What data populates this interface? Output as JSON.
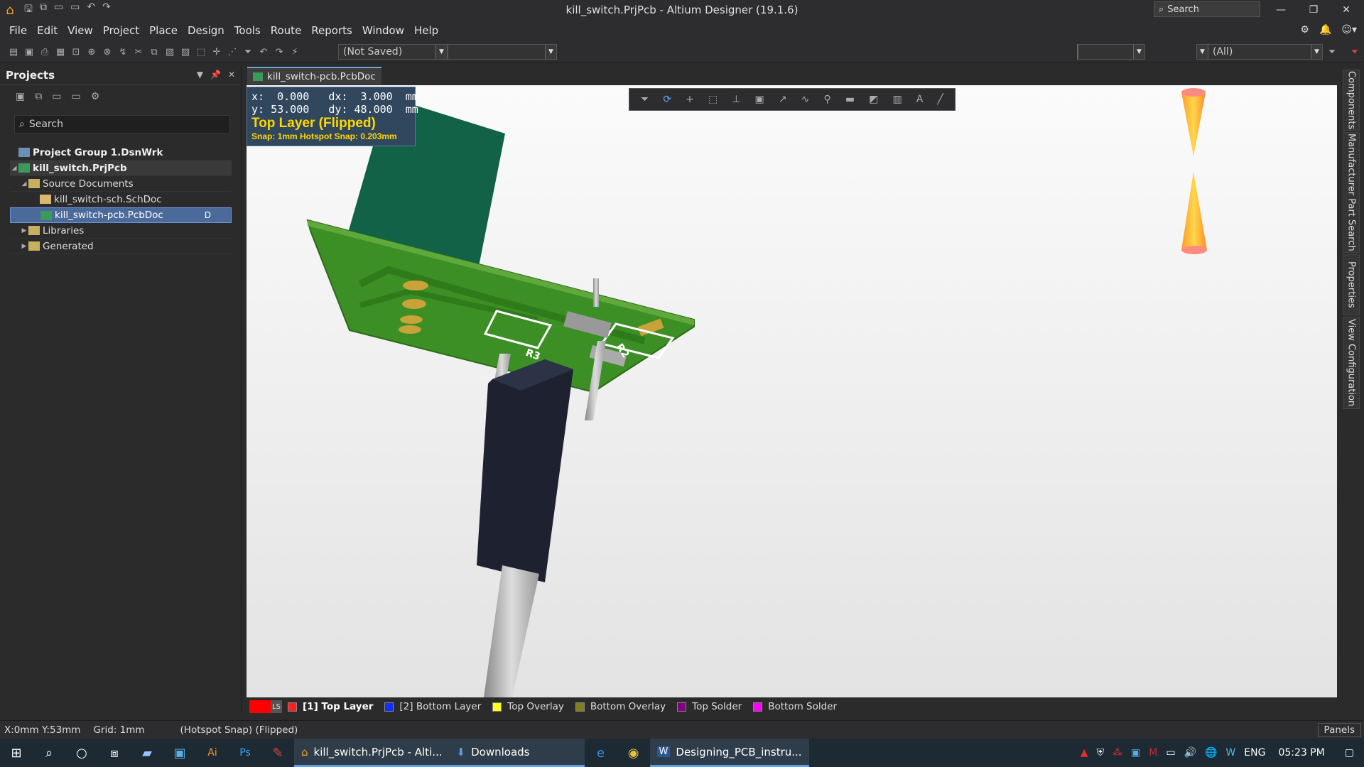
{
  "window": {
    "title": "kill_switch.PrjPcb - Altium Designer (19.1.6)",
    "search_label": "Search"
  },
  "menu": [
    "File",
    "Edit",
    "View",
    "Project",
    "Place",
    "Design",
    "Tools",
    "Route",
    "Reports",
    "Window",
    "Help"
  ],
  "toolbar": {
    "saved_state": "(Not Saved)",
    "filter_all": "(All)"
  },
  "projects_panel": {
    "title": "Projects",
    "search_placeholder": "Search",
    "tree": {
      "group": "Project Group 1.DsnWrk",
      "project": "kill_switch.PrjPcb",
      "source_folder": "Source Documents",
      "sch": "kill_switch-sch.SchDoc",
      "pcb": "kill_switch-pcb.PcbDoc",
      "pcb_flag": "D",
      "libraries": "Libraries",
      "generated": "Generated"
    }
  },
  "document_tab": "kill_switch-pcb.PcbDoc",
  "hud": {
    "line1": "x:  0.000   dx:  3.000  mm",
    "line2": "y: 53.000   dy: 48.000  mm",
    "layer": "Top Layer (Flipped)",
    "snap": "Snap: 1mm Hotspot Snap: 0.203mm"
  },
  "right_panels": [
    "Components",
    "Manufacturer Part Search",
    "Properties",
    "View Configuration"
  ],
  "layers": {
    "ls": "LS",
    "items": [
      {
        "label": "[1] Top Layer",
        "color": "#ff2020",
        "active": true
      },
      {
        "label": "[2] Bottom Layer",
        "color": "#1030ff",
        "active": false
      },
      {
        "label": "Top Overlay",
        "color": "#ffff20",
        "active": false
      },
      {
        "label": "Bottom Overlay",
        "color": "#808020",
        "active": false
      },
      {
        "label": "Top Solder",
        "color": "#800080",
        "active": false
      },
      {
        "label": "Bottom Solder",
        "color": "#ff00ff",
        "active": false
      }
    ]
  },
  "status": {
    "position": "X:0mm Y:53mm",
    "grid": "Grid: 1mm",
    "mode": "(Hotspot Snap) (Flipped)",
    "panels_button": "Panels"
  },
  "taskbar": {
    "apps": [
      {
        "label": "kill_switch.PrjPcb - Alti..."
      },
      {
        "label": "Downloads"
      },
      {
        "label": "Designing_PCB_instru..."
      }
    ],
    "language": "ENG",
    "time": "05:23 PM"
  },
  "pcb_labels": {
    "r3": "R3",
    "r2": "R2"
  }
}
